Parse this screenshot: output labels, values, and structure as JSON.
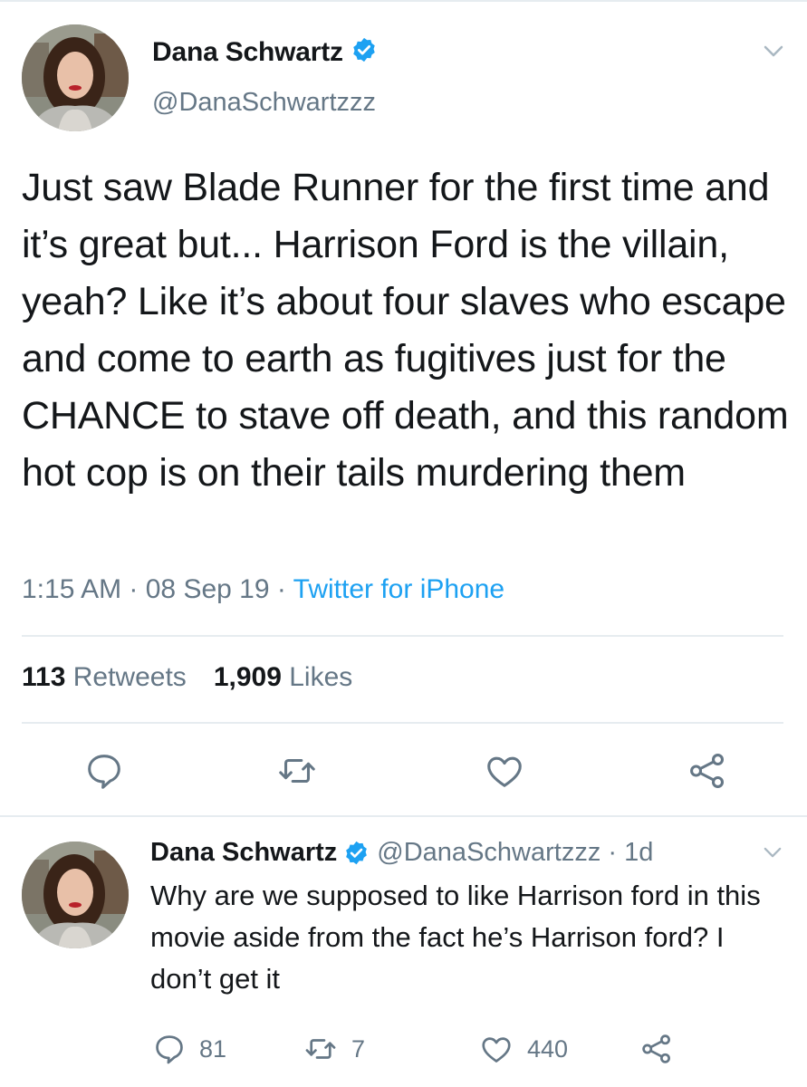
{
  "main_tweet": {
    "author_name": "Dana Schwartz",
    "handle": "@DanaSchwartzzz",
    "text": "Just saw Blade Runner for the first time and it’s great but... Harrison Ford is the villain, yeah? Like it’s about four slaves who escape and come to earth as fugitives just for the CHANCE to stave off death, and this random hot cop is on their tails murdering them",
    "time": "1:15 AM",
    "date": "08 Sep 19",
    "separator": " · ",
    "source": "Twitter for iPhone",
    "retweet_count": "113",
    "retweet_label": "Retweets",
    "like_count": "1,909",
    "like_label": "Likes"
  },
  "reply_tweet": {
    "author_name": "Dana Schwartz",
    "handle_age": "@DanaSchwartzzz · 1d",
    "text": "Why are we supposed to like Harrison ford in this movie aside from the fact he’s Harrison ford? I don’t get it",
    "reply_count": "81",
    "retweet_count": "7",
    "like_count": "440"
  },
  "icons": {
    "verified": "verified-badge-icon",
    "caret": "chevron-down-icon",
    "reply": "reply-bubble-icon",
    "retweet": "retweet-icon",
    "like": "heart-icon",
    "share": "share-icon"
  },
  "colors": {
    "primary_text": "#14171a",
    "secondary_text": "#657786",
    "link": "#1da1f2",
    "verified": "#1da1f2",
    "divider": "#e6ecf0"
  }
}
